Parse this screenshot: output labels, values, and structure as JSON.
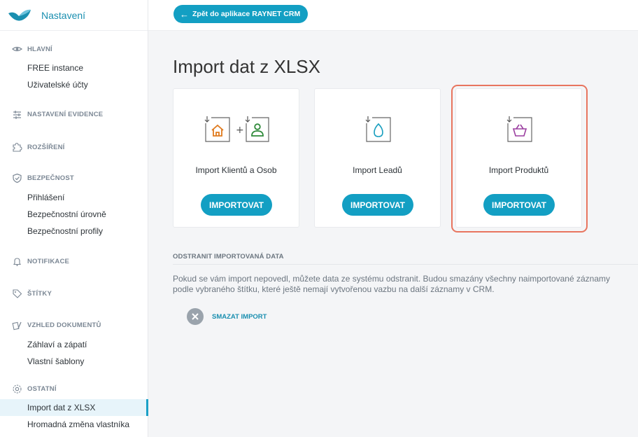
{
  "sidebar": {
    "title": "Nastavení",
    "groups": {
      "hlavni": {
        "label": "HLAVNÍ",
        "items": [
          "FREE instance",
          "Uživatelské účty"
        ]
      },
      "evidence": {
        "label": "NASTAVENÍ EVIDENCE"
      },
      "rozsireni": {
        "label": "ROZŠÍŘENÍ"
      },
      "bezpecnost": {
        "label": "BEZPEČNOST",
        "items": [
          "Přihlášení",
          "Bezpečnostní úrovně",
          "Bezpečnostní profily"
        ]
      },
      "notifikace": {
        "label": "NOTIFIKACE"
      },
      "stitky": {
        "label": "ŠTÍTKY"
      },
      "vzhled": {
        "label": "VZHLED DOKUMENTŮ",
        "items": [
          "Záhlaví a zápatí",
          "Vlastní šablony"
        ]
      },
      "ostatni": {
        "label": "OSTATNÍ",
        "items": [
          "Import dat z XLSX",
          "Hromadná změna vlastníka"
        ]
      }
    }
  },
  "topbar": {
    "back_label": "Zpět do aplikace RAYNET CRM"
  },
  "main": {
    "title": "Import dat z XLSX",
    "cards": [
      {
        "label": "Import Klientů a Osob",
        "button": "IMPORTOVAT"
      },
      {
        "label": "Import Leadů",
        "button": "IMPORTOVAT"
      },
      {
        "label": "Import Produktů",
        "button": "IMPORTOVAT"
      }
    ],
    "remove_section": {
      "label": "ODSTRANIT IMPORTOVANÁ DATA",
      "description": "Pokud se vám import nepovedl, můžete data ze systému odstranit. Budou smazány všechny naimportované záznamy podle vybraného štítku, které ještě nemají vytvořenou vazbu na další záznamy v CRM.",
      "delete_label": "SMAZAT IMPORT"
    }
  },
  "colors": {
    "accent": "#139fc3",
    "highlight": "#e8755f",
    "active_bg": "#e7f4fa"
  },
  "active_item": "Import dat z XLSX"
}
